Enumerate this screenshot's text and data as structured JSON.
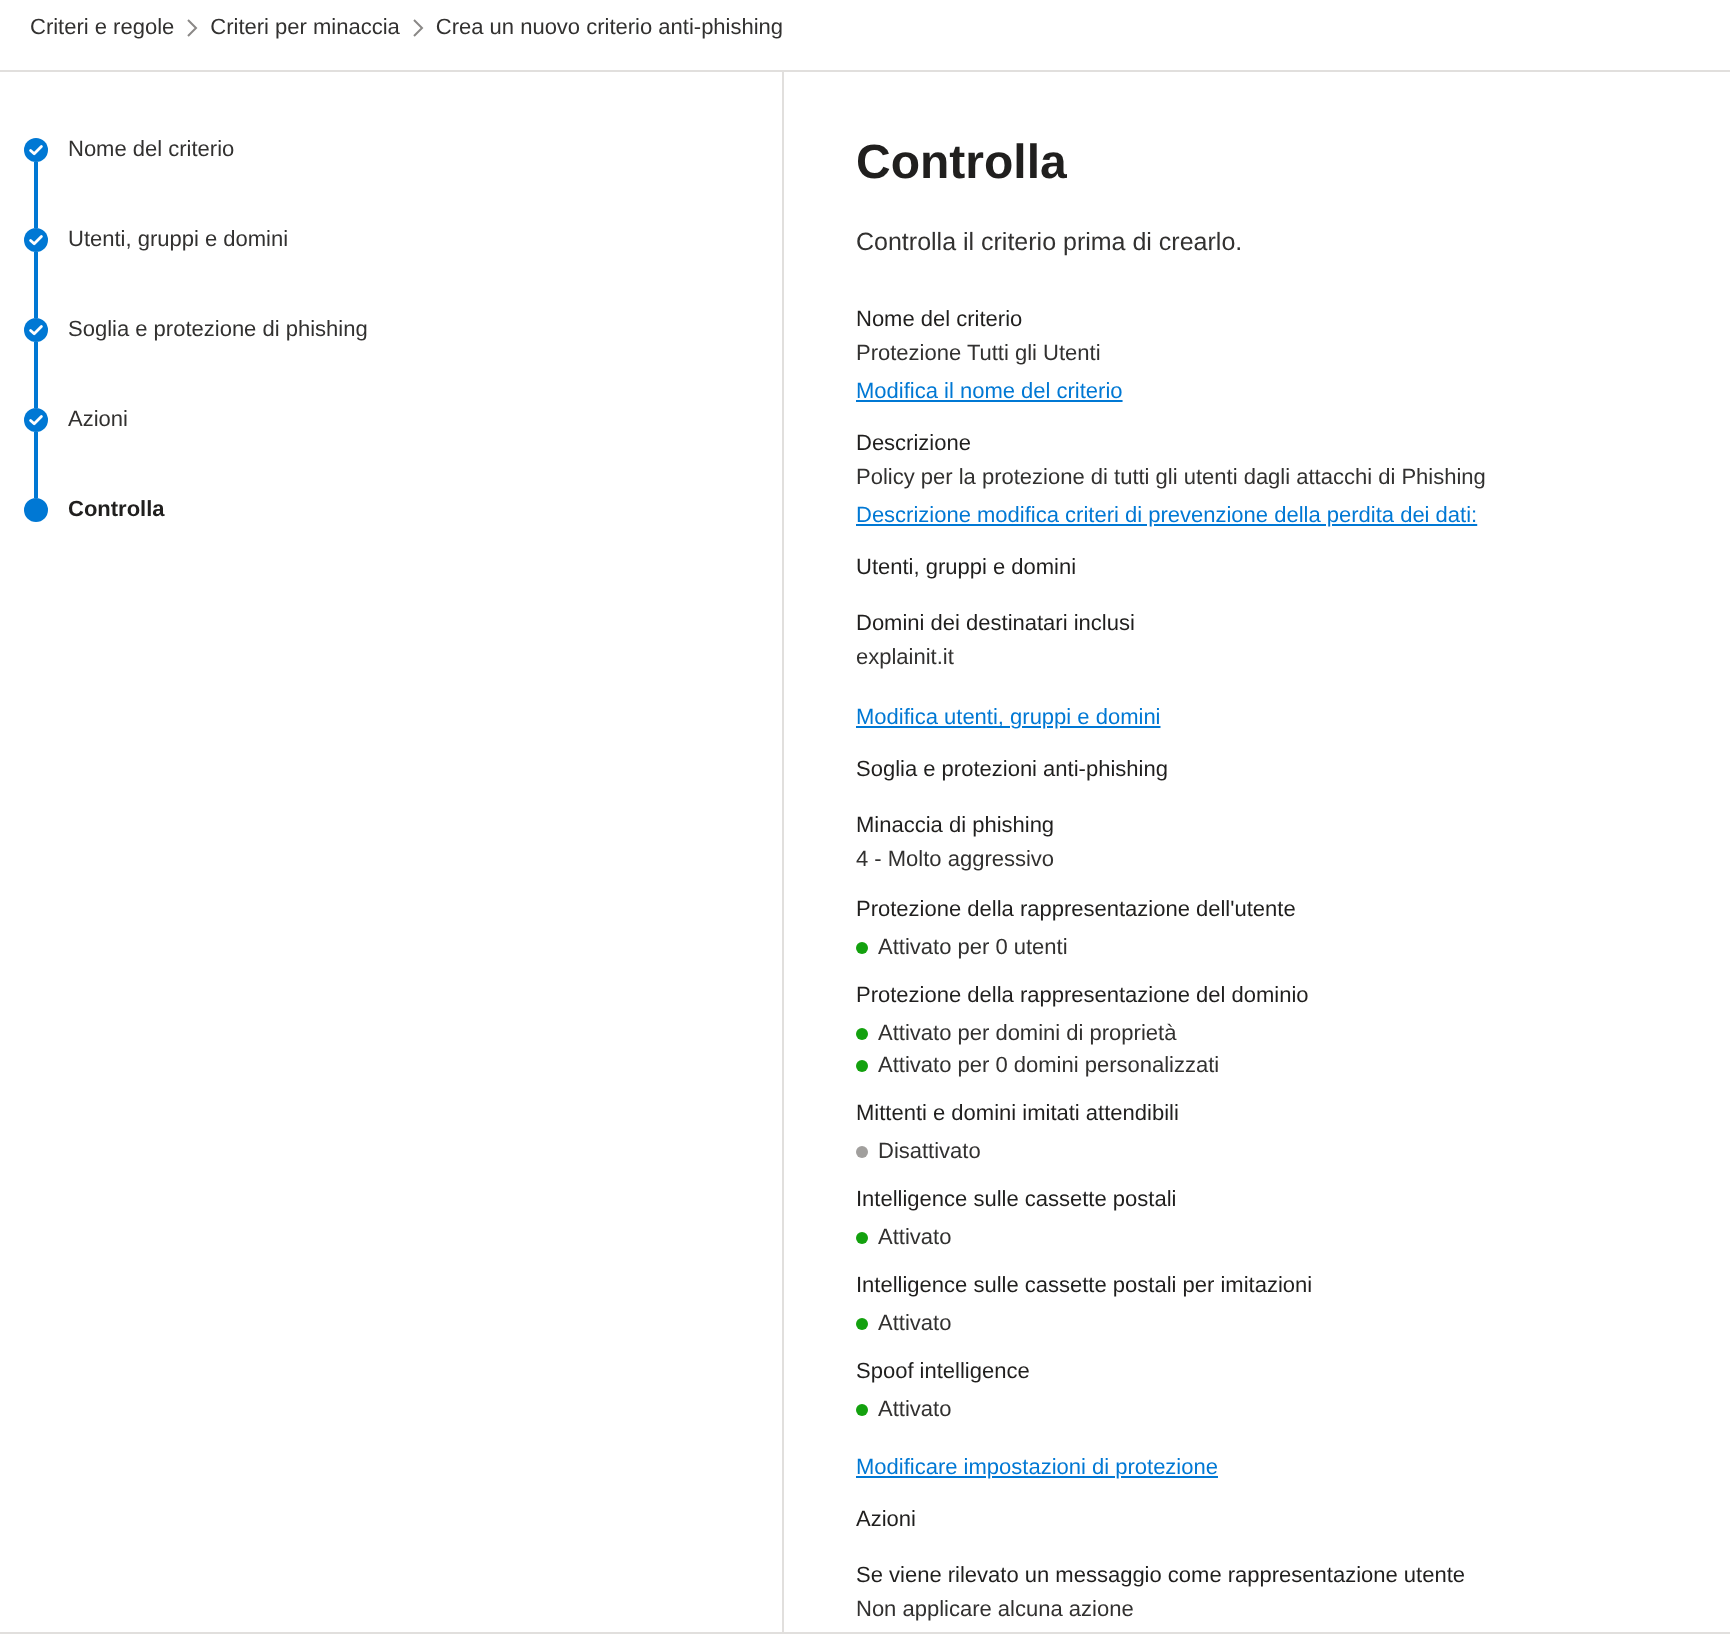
{
  "breadcrumb": [
    {
      "label": "Criteri e regole"
    },
    {
      "label": "Criteri per minaccia"
    },
    {
      "label": "Crea un nuovo criterio anti-phishing"
    }
  ],
  "steps": [
    {
      "label": "Nome del criterio",
      "completed": true,
      "selected": false
    },
    {
      "label": "Utenti, gruppi e domini",
      "completed": true,
      "selected": false
    },
    {
      "label": "Soglia e protezione di phishing",
      "completed": true,
      "selected": false
    },
    {
      "label": "Azioni",
      "completed": true,
      "selected": false
    },
    {
      "label": "Controlla",
      "completed": false,
      "selected": true
    }
  ],
  "review": {
    "title": "Controlla",
    "subtitle": "Controlla il criterio prima di crearlo.",
    "sections": [
      {
        "fields": [
          {
            "label": "Nome del criterio",
            "values": [
              {
                "text": "Protezione Tutti gli Utenti"
              }
            ]
          }
        ],
        "link": "Modifica il nome del criterio"
      },
      {
        "fields": [
          {
            "label": "Descrizione",
            "values": [
              {
                "text": "Policy per la protezione di tutti gli utenti dagli attacchi di Phishing"
              }
            ]
          }
        ],
        "link": "Descrizione modifica criteri di prevenzione della perdita dei dati:"
      },
      {
        "heading": "Utenti, gruppi e domini",
        "fields": [
          {
            "label": "Domini dei destinatari inclusi",
            "values": [
              {
                "text": "explainit.it"
              }
            ]
          }
        ],
        "link": "Modifica utenti, gruppi e domini"
      },
      {
        "heading": "Soglia e protezioni anti-phishing",
        "fields": [
          {
            "label": "Minaccia di phishing",
            "values": [
              {
                "text": "4 - Molto aggressivo"
              }
            ]
          },
          {
            "label": "Protezione della rappresentazione dell'utente",
            "values": [
              {
                "text": "Attivato per 0 utenti",
                "color": "#13a10e"
              }
            ]
          },
          {
            "label": "Protezione della rappresentazione del dominio",
            "values": [
              {
                "text": "Attivato per domini di proprietà",
                "color": "#13a10e"
              },
              {
                "text": "Attivato per 0 domini personalizzati",
                "color": "#13a10e"
              }
            ]
          },
          {
            "label": "Mittenti e domini imitati attendibili",
            "values": [
              {
                "text": "Disattivato",
                "color": "#a19f9d"
              }
            ]
          },
          {
            "label": "Intelligence sulle cassette postali",
            "values": [
              {
                "text": "Attivato",
                "color": "#13a10e"
              }
            ]
          },
          {
            "label": "Intelligence sulle cassette postali per imitazioni",
            "values": [
              {
                "text": "Attivato",
                "color": "#13a10e"
              }
            ]
          },
          {
            "label": "Spoof intelligence",
            "values": [
              {
                "text": "Attivato",
                "color": "#13a10e"
              }
            ]
          }
        ],
        "link": "Modificare impostazioni di protezione"
      },
      {
        "heading": "Azioni",
        "fields": [
          {
            "label": "Se viene rilevato un messaggio come rappresentazione utente",
            "values": [
              {
                "text": "Non applicare alcuna azione"
              }
            ]
          }
        ]
      }
    ]
  }
}
